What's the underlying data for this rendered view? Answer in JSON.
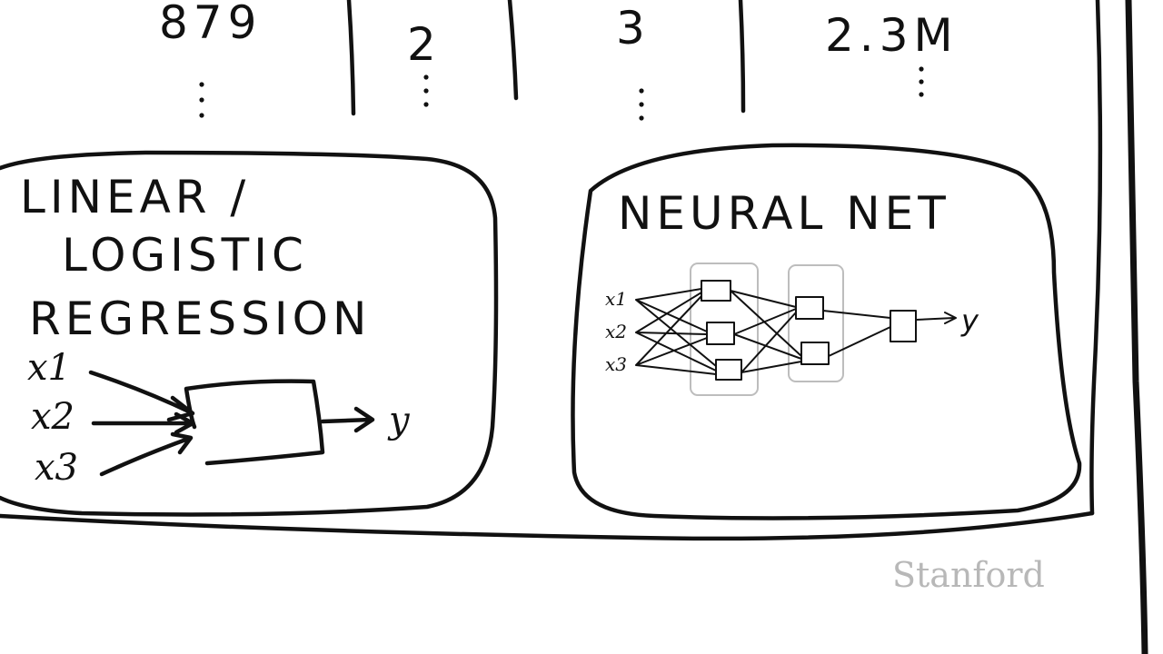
{
  "top_row": {
    "values": [
      "879",
      "2",
      "3",
      "2.3M"
    ],
    "ellipsis": "⋮"
  },
  "linear_box": {
    "title_lines": [
      "LINEAR /",
      "LOGISTIC",
      "REGRESSION"
    ],
    "inputs": [
      "x1",
      "x2",
      "x3"
    ],
    "output": "y"
  },
  "neural_box": {
    "title": "NEURAL NET",
    "inputs": [
      "x1",
      "x2",
      "x3"
    ],
    "output": "y"
  },
  "watermark": "Stanford"
}
